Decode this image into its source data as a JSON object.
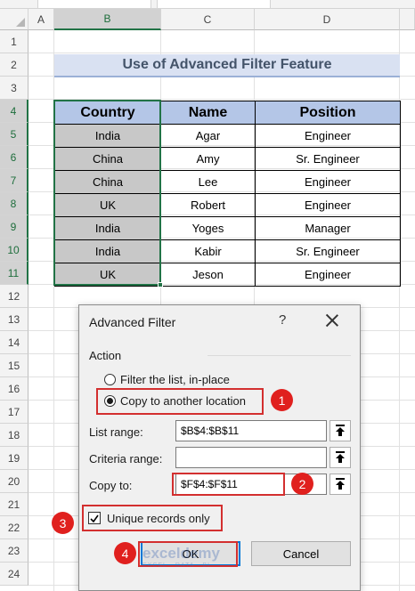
{
  "sheet": {
    "columns": [
      "A",
      "B",
      "C",
      "D"
    ],
    "selected_column": "B",
    "rows": [
      "1",
      "2",
      "3",
      "4",
      "5",
      "6",
      "7",
      "8",
      "9",
      "10",
      "11",
      "12",
      "13",
      "14",
      "15",
      "16",
      "17",
      "18",
      "19",
      "20",
      "21",
      "22",
      "23",
      "24"
    ],
    "selected_rows": [
      "4",
      "5",
      "6",
      "7",
      "8",
      "9",
      "10",
      "11"
    ]
  },
  "title": "Use of Advanced Filter Feature",
  "table": {
    "headers": [
      "Country",
      "Name",
      "Position"
    ],
    "rows": [
      [
        "India",
        "Agar",
        "Engineer"
      ],
      [
        "China",
        "Amy",
        "Sr. Engineer"
      ],
      [
        "China",
        "Lee",
        "Engineer"
      ],
      [
        "UK",
        "Robert",
        "Engineer"
      ],
      [
        "India",
        "Yoges",
        "Manager"
      ],
      [
        "India",
        "Kabir",
        "Sr. Engineer"
      ],
      [
        "UK",
        "Jeson",
        "Engineer"
      ]
    ]
  },
  "dialog": {
    "title": "Advanced Filter",
    "help": "?",
    "action_label": "Action",
    "radio_filter": "Filter the list, in-place",
    "radio_copy": "Copy to another location",
    "list_range_label": "List range:",
    "list_range_value": "$B$4:$B$11",
    "criteria_range_label": "Criteria range:",
    "criteria_range_value": "",
    "copy_to_label": "Copy to:",
    "copy_to_value": "$F$4:$F$11",
    "unique_label": "Unique records only",
    "ok_label": "OK",
    "cancel_label": "Cancel"
  },
  "badges": [
    "1",
    "2",
    "3",
    "4"
  ],
  "watermark": {
    "name": "exceldemy",
    "tagline": "EXCEL · DATA · BI"
  },
  "colors": {
    "header_fill": "#b4c6e7",
    "title_fill": "#d9e1f2",
    "selection": "#217346",
    "badge": "#e0201e"
  }
}
